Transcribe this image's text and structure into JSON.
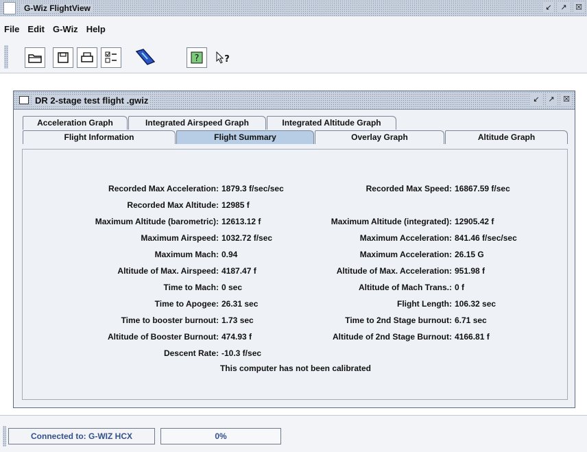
{
  "window": {
    "title": "G-Wiz FlightView",
    "controls": [
      "restore-icon",
      "maximize-icon",
      "close-icon"
    ]
  },
  "menu": [
    "File",
    "Edit",
    "G-Wiz",
    "Help"
  ],
  "toolbar": {
    "buttons": [
      "open-icon",
      "save-icon",
      "print-icon",
      "checklist-icon",
      "device-icon",
      "help-icon",
      "context-help-icon"
    ]
  },
  "document": {
    "title": "DR 2-stage test flight .gwiz",
    "tabs_row1": [
      "Acceleration Graph",
      "Integrated Airspeed Graph",
      "Integrated Altitude Graph"
    ],
    "tabs_row2": [
      "Flight Information",
      "Flight Summary",
      "Overlay Graph",
      "Altitude Graph"
    ],
    "active_tab": "Flight Summary"
  },
  "summary": {
    "left": [
      {
        "label": "Recorded Max Acceleration:",
        "value": "1879.3 f/sec/sec"
      },
      {
        "label": "Recorded Max Altitude:",
        "value": "12985 f"
      },
      {
        "label": "Maximum Altitude (barometric):",
        "value": "12613.12 f"
      },
      {
        "label": "Maximum Airspeed:",
        "value": "1032.72 f/sec"
      },
      {
        "label": "Maximum Mach:",
        "value": "0.94"
      },
      {
        "label": "Altitude of Max. Airspeed:",
        "value": "4187.47 f"
      },
      {
        "label": "Time to Mach:",
        "value": "0 sec"
      },
      {
        "label": "Time to Apogee:",
        "value": "26.31 sec"
      },
      {
        "label": "Time to booster burnout:",
        "value": "1.73 sec"
      },
      {
        "label": "Altitude of Booster Burnout:",
        "value": "474.93 f"
      },
      {
        "label": "Descent Rate:",
        "value": "-10.3 f/sec"
      }
    ],
    "right": [
      {
        "label": "Recorded Max Speed:",
        "value": "16867.59 f/sec"
      },
      {
        "label": "",
        "value": ""
      },
      {
        "label": "Maximum Altitude (integrated):",
        "value": "12905.42 f"
      },
      {
        "label": "Maximum Acceleration:",
        "value": "841.46 f/sec/sec"
      },
      {
        "label": "Maximum Acceleration:",
        "value": "26.15 G"
      },
      {
        "label": "Altitude of Max. Acceleration:",
        "value": "951.98 f"
      },
      {
        "label": "Altitude of Mach Trans.:",
        "value": "0 f"
      },
      {
        "label": "Flight Length:",
        "value": "106.32 sec"
      },
      {
        "label": "Time to 2nd Stage burnout:",
        "value": "6.71 sec"
      },
      {
        "label": "Altitude of 2nd Stage Burnout:",
        "value": "4166.81 f"
      }
    ],
    "note": "This computer has not been calibrated"
  },
  "status": {
    "connection": "Connected to: G-WIZ HCX",
    "progress_text": "0%",
    "progress": 0
  }
}
